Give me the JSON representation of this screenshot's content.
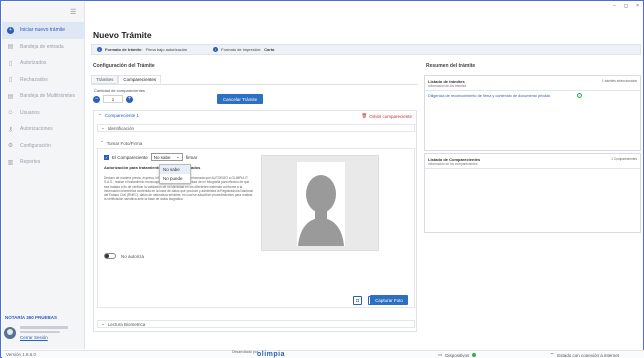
{
  "window": {
    "controls": [
      "−",
      "◻",
      "×"
    ]
  },
  "sidebar": {
    "items": [
      {
        "label": "Iniciar nuevo trámite",
        "icon": "plus-icon",
        "active": true
      },
      {
        "label": "Bandeja de entrada",
        "icon": "inbox-icon"
      },
      {
        "label": "Autorizados",
        "icon": "document-check-icon"
      },
      {
        "label": "Rechazados",
        "icon": "document-x-icon"
      },
      {
        "label": "Bandeja de Multitrámites",
        "icon": "stack-icon"
      },
      {
        "label": "Usuarios",
        "icon": "user-icon"
      },
      {
        "label": "Autorizaciones",
        "icon": "key-icon"
      },
      {
        "label": "Configuración",
        "icon": "gear-icon"
      },
      {
        "label": "Reportes",
        "icon": "chart-icon"
      }
    ],
    "org_name": "NOTARÍA 360 PRUEBAS",
    "logout_label": "Cerrar Sesión"
  },
  "footer": {
    "version": "Versión 1.8.6.0",
    "developed_by": "Desarrollado por",
    "brand": "olimpia",
    "devices_label": "Dispositivos",
    "connection_label": "Estado con conexión a internet"
  },
  "main": {
    "title": "Nuevo Trámite",
    "info": {
      "format_label": "Formato de trámite:",
      "format_value": "Firma bajo autorización",
      "print_label": "Formato de impresión:",
      "print_value": "Carta"
    },
    "config": {
      "title": "Configuración del Trámite",
      "tabs": [
        "Trámites",
        "Comparecientes"
      ],
      "count_label": "Cantidad de comparecientes",
      "count_value": "1",
      "cancel_label": "Cancelar Trámite",
      "card": {
        "title": "Compareciente 1",
        "omit_label": "Omitir compareciente",
        "sections": {
          "identification": "Identificación",
          "photo": "Tomar Foto/Firma",
          "biometric": "Lectura Biometrica"
        },
        "consent_prefix": "El Compareciente",
        "consent_select": "No sabe",
        "consent_suffix": "firmar",
        "dropdown_options": [
          "No sabe",
          "No puede"
        ],
        "auth_label": "Autorización para tratamiento",
        "auth_label2": "ados",
        "auth_text": "Declaro de manera previa, expresa, informada y voluntaria e informada que AUTORIZO a OLIMPIA IT S.A.S., realice el tratamiento monocapsado, para hacer la captura de mi fotografía para efectos de que sea tratada a fin de verificar la validación de mi identidad en los diferentes sistemas conforme a la información biométrica contenida en la base de datos que produce y administra la Registraduría Nacional del Estado Civil (RNEC), datos de naturaleza sensible, en cual se adscriben procedimientos para realizar la verificación sensitiva ante la base de datos biográfica",
        "no_authorize": "No autoriza",
        "capture_label": "Capturar Foto"
      }
    }
  },
  "summary": {
    "title": "Resumen del trámite",
    "procedures": {
      "title": "Listado de trámites",
      "subtitle": "Información de los trámites",
      "count": "1 trámites seleccionados",
      "items": [
        "Diligencia de reconocimiento de firma y contenido de documento privado"
      ]
    },
    "appearing": {
      "title": "Listado de Comparecientes",
      "subtitle": "Información de los comparecientes",
      "count": "1 Comparecientes"
    }
  },
  "colors": {
    "accent": "#2d5eb8",
    "danger": "#c03434",
    "success": "#2db34a"
  }
}
